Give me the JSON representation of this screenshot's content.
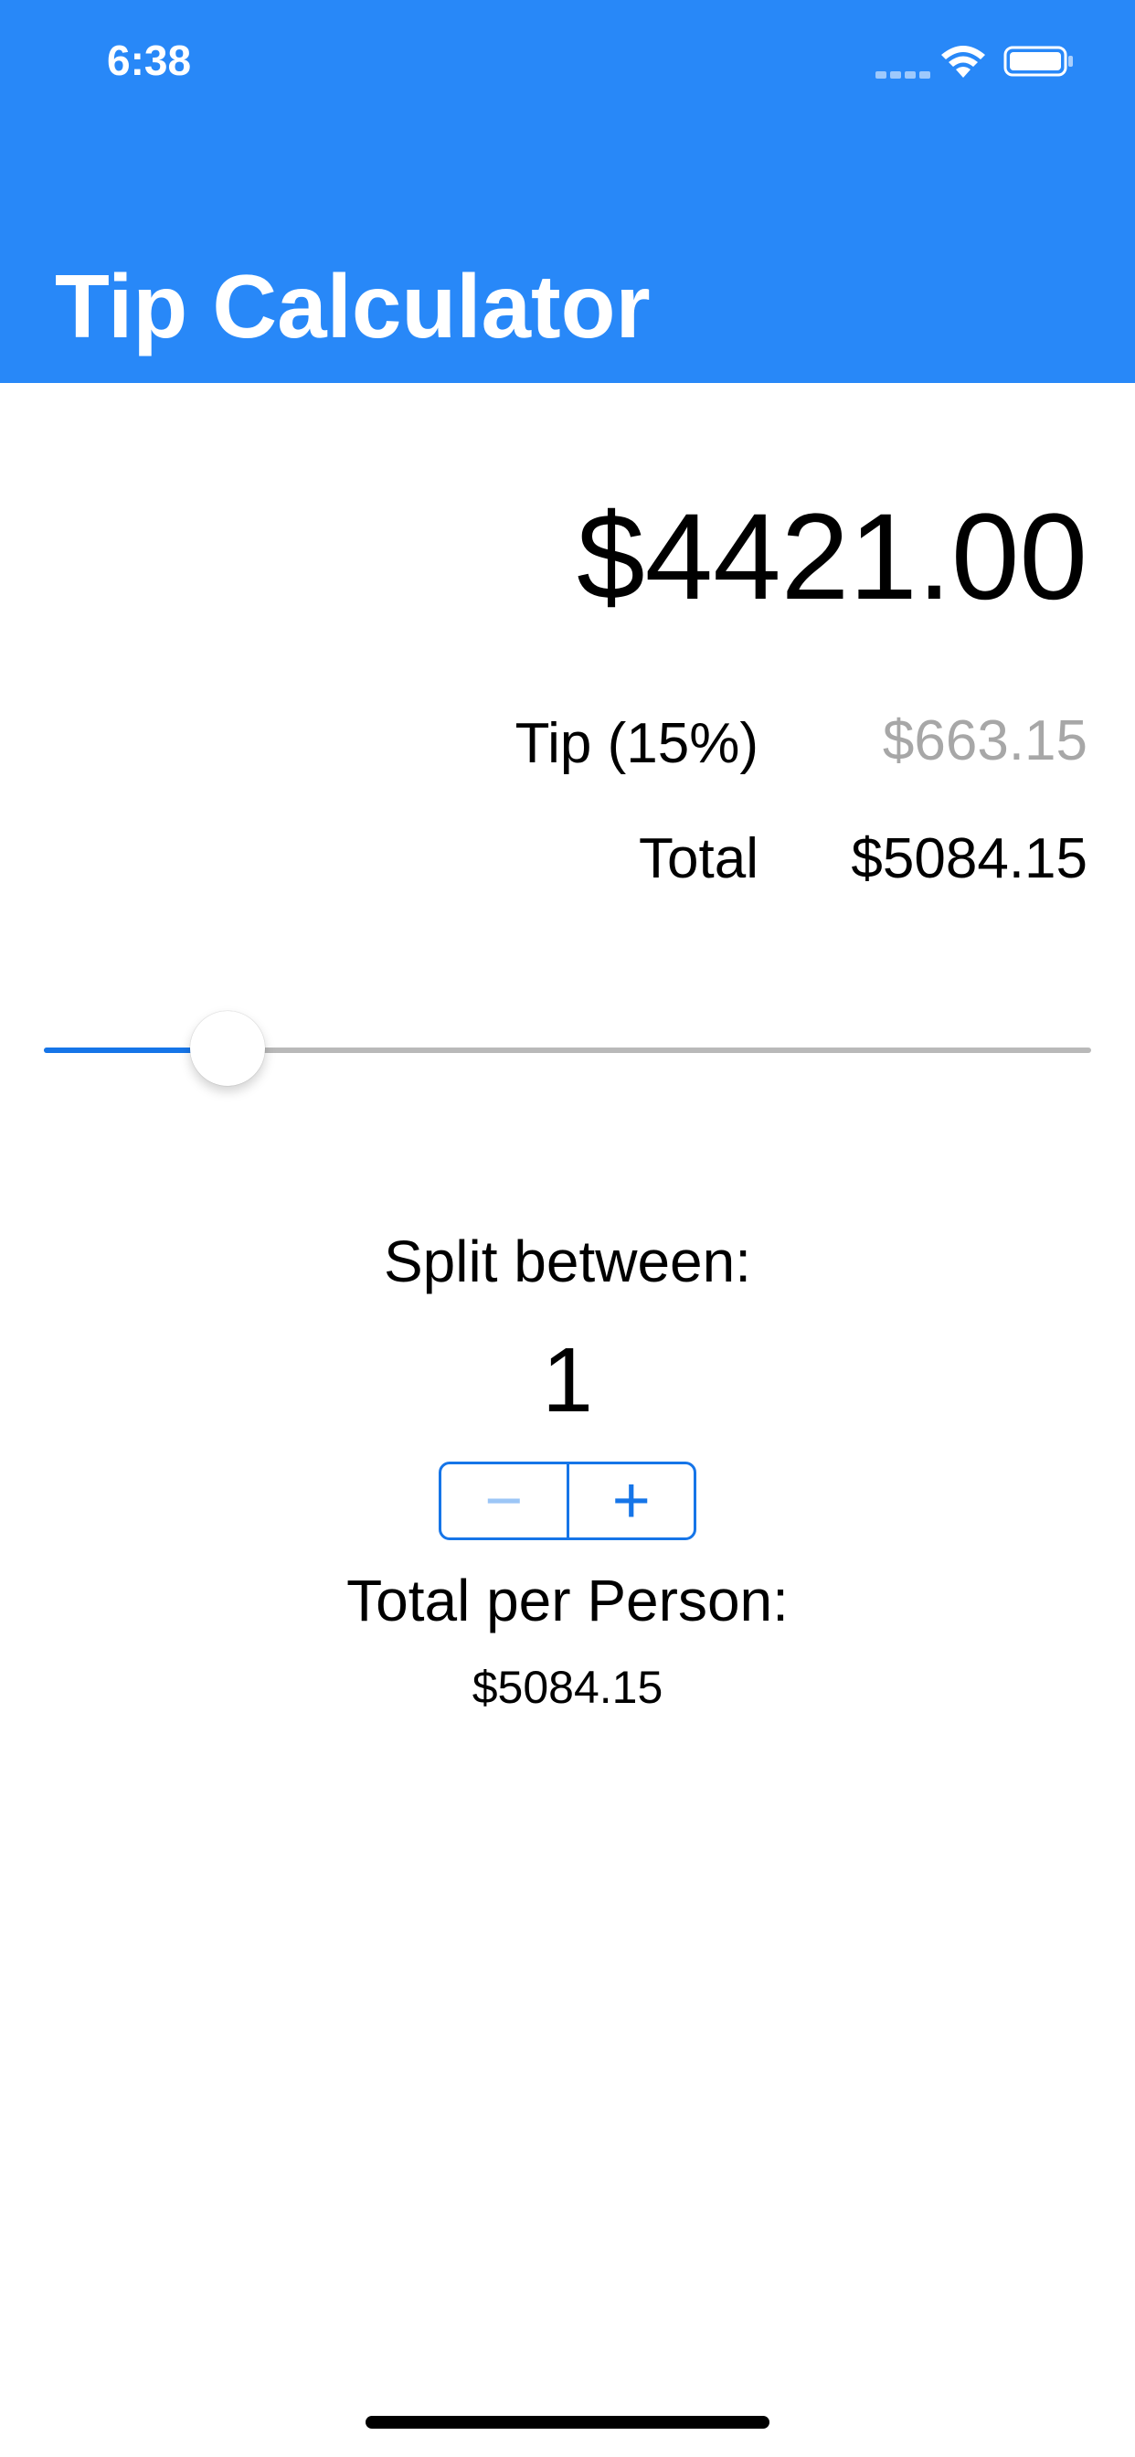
{
  "status_bar": {
    "time": "6:38",
    "icons": [
      "cellular-signal-icon",
      "wifi-icon",
      "battery-icon"
    ]
  },
  "navigation": {
    "title": "Tip Calculator"
  },
  "bill": {
    "amount": "$4421.00"
  },
  "summary": {
    "tip_label": "Tip (15%)",
    "tip_value": "$663.15",
    "total_label": "Total",
    "total_value": "$5084.15"
  },
  "tip_slider": {
    "value_percent": 15,
    "value_fraction": 0.15
  },
  "split": {
    "label": "Split between:",
    "count": "1",
    "decrement_symbol": "−",
    "increment_symbol": "+"
  },
  "per_person": {
    "label": "Total per Person:",
    "value": "$5084.15"
  },
  "colors": {
    "header": "#2888F8",
    "accent": "#1675E8",
    "tip_value": "#A7A7A7",
    "text": "#000000"
  }
}
